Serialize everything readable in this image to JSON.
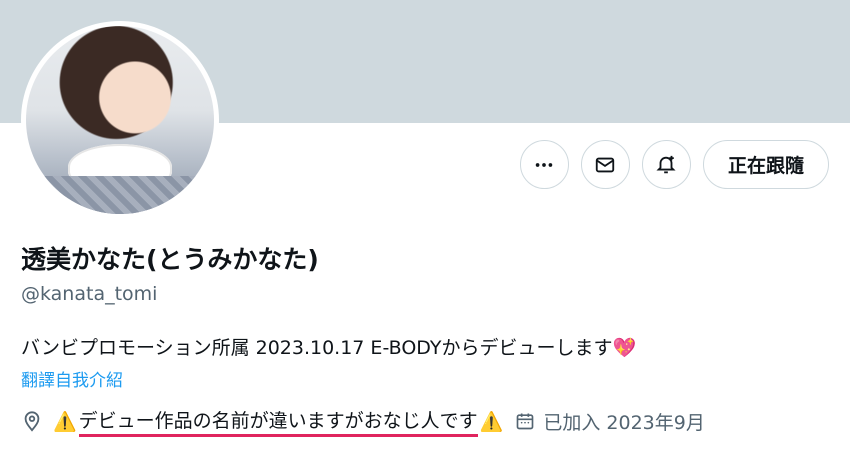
{
  "profile": {
    "display_name": "透美かなた(とうみかなた)",
    "handle": "@kanata_tomi",
    "bio_text": "バンビプロモーション所属 2023.10.17 E-BODYからデビューします",
    "bio_emoji": "💖",
    "translate_link": "翻譯自我介紹",
    "location": "デビュー作品の名前が違いますがおなじ人です",
    "location_warning_emoji": "⚠️",
    "joined": "已加入 2023年9月"
  },
  "actions": {
    "more_icon": "more-horizontal-icon",
    "message_icon": "mail-icon",
    "notify_icon": "bell-plus-icon",
    "follow_label": "正在跟隨"
  },
  "colors": {
    "banner": "#cfd9de",
    "link": "#1d9bf0",
    "underline": "#e0245e",
    "secondary_text": "#536471"
  }
}
